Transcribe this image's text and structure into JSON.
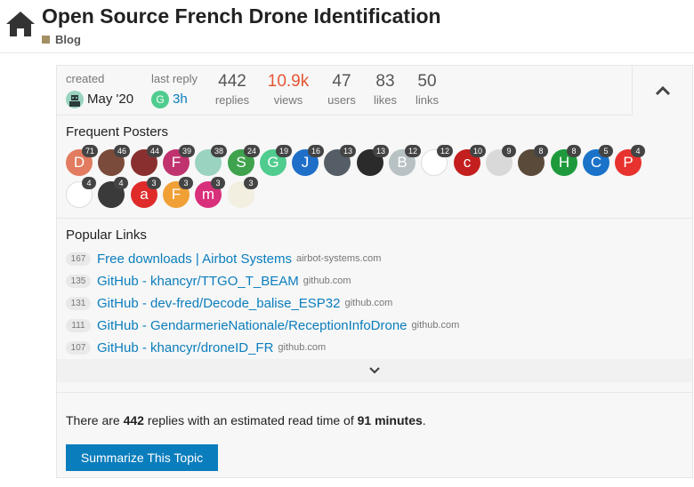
{
  "topic": {
    "title": "Open Source French Drone Identification",
    "category": "Blog",
    "category_color": "#a48e63"
  },
  "stats": {
    "created_label": "created",
    "created_value": "May '20",
    "last_reply_label": "last reply",
    "last_reply_value": "3h",
    "last_reply_avatar_letter": "G",
    "replies_num": "442",
    "replies_label": "replies",
    "views_num": "10.9k",
    "views_label": "views",
    "users_num": "47",
    "users_label": "users",
    "likes_num": "83",
    "likes_label": "likes",
    "links_num": "50",
    "links_label": "links"
  },
  "frequent_posters": {
    "title": "Frequent Posters",
    "posters": [
      {
        "letter": "D",
        "count": "71",
        "color": "#e27b5f"
      },
      {
        "letter": "",
        "count": "46",
        "color": "#7a4b3a"
      },
      {
        "letter": "",
        "count": "44",
        "color": "#8a2f2f"
      },
      {
        "letter": "F",
        "count": "39",
        "color": "#c0336e"
      },
      {
        "letter": "",
        "count": "38",
        "color": "#9ad3c0"
      },
      {
        "letter": "S",
        "count": "24",
        "color": "#3fa34d"
      },
      {
        "letter": "G",
        "count": "19",
        "color": "#4fcc8e"
      },
      {
        "letter": "J",
        "count": "16",
        "color": "#1f6fc9"
      },
      {
        "letter": "",
        "count": "13",
        "color": "#555e66"
      },
      {
        "letter": "",
        "count": "13",
        "color": "#2b2b2b"
      },
      {
        "letter": "B",
        "count": "12",
        "color": "#b8c2c4"
      },
      {
        "letter": "",
        "count": "12",
        "color": "#ffffff"
      },
      {
        "letter": "c",
        "count": "10",
        "color": "#c41f1f"
      },
      {
        "letter": "",
        "count": "9",
        "color": "#d9d9d9"
      },
      {
        "letter": "",
        "count": "8",
        "color": "#5a4a3a"
      },
      {
        "letter": "H",
        "count": "8",
        "color": "#1e9a3c"
      },
      {
        "letter": "C",
        "count": "5",
        "color": "#1a73c9"
      },
      {
        "letter": "P",
        "count": "4",
        "color": "#e8322e"
      },
      {
        "letter": "",
        "count": "4",
        "color": "#ffffff"
      },
      {
        "letter": "",
        "count": "4",
        "color": "#3a3a3a"
      },
      {
        "letter": "a",
        "count": "3",
        "color": "#e02b2b"
      },
      {
        "letter": "F",
        "count": "3",
        "color": "#f0a035"
      },
      {
        "letter": "m",
        "count": "3",
        "color": "#d8307a"
      },
      {
        "letter": "",
        "count": "3",
        "color": "#f2eee0"
      }
    ]
  },
  "popular_links": {
    "title": "Popular Links",
    "links": [
      {
        "clicks": "167",
        "title": "Free downloads | Airbot Systems",
        "domain": "airbot-systems.com"
      },
      {
        "clicks": "135",
        "title": "GitHub - khancyr/TTGO_T_BEAM",
        "domain": "github.com"
      },
      {
        "clicks": "131",
        "title": "GitHub - dev-fred/Decode_balise_ESP32",
        "domain": "github.com"
      },
      {
        "clicks": "111",
        "title": "GitHub - GendarmerieNationale/ReceptionInfoDrone",
        "domain": "github.com"
      },
      {
        "clicks": "107",
        "title": "GitHub - khancyr/droneID_FR",
        "domain": "github.com"
      }
    ]
  },
  "summary": {
    "prefix": "There are ",
    "replies": "442",
    "middle": " replies with an estimated read time of ",
    "read_time": "91 minutes",
    "suffix": ".",
    "button_label": "Summarize This Topic"
  },
  "colors": {
    "link_blue": "#0a7dbd",
    "hot_views": "#e45735"
  }
}
